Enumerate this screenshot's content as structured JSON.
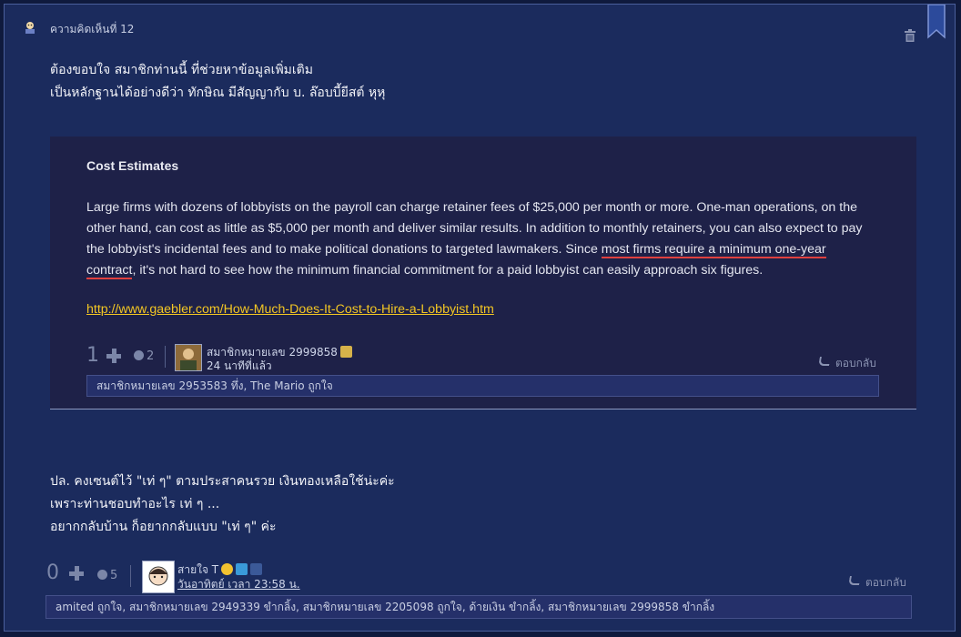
{
  "comment": {
    "label": "ความคิดเห็นที่ 12",
    "message_lines": [
      "ต้องขอบใจ สมาชิกท่านนี้ ที่ช่วยหาข้อมูลเพิ่มเติม",
      "เป็นหลักฐานได้อย่างดีว่า ทักษิณ มีสัญญากับ บ. ล๊อบบี้ยีสต์ หุหุ"
    ],
    "quote": {
      "title": "Cost Estimates",
      "para_before": "Large firms with dozens of lobbyists on the payroll can charge retainer fees of $25,000 per month or more. One-man operations, on the other hand, can cost as little as $5,000 per month and deliver similar results. In addition to monthly retainers, you can also expect to pay the lobbyist's incidental fees and to make political donations to targeted lawmakers. Since ",
      "para_underlined": "most firms require a minimum one-year contract",
      "para_after": ", it's not hard to see how the minimum financial commitment for a paid lobbyist can easily approach six figures.",
      "link": "http://www.gaebler.com/How-Much-Does-It-Cost-to-Hire-a-Lobbyist.htm"
    },
    "quote_footer": {
      "votes": "1",
      "emotion_count": "2",
      "user_name": "สมาชิกหมายเลข 2999858",
      "time": "24 นาทีที่แล้ว",
      "reply_label": "ตอบกลับ",
      "likes": "สมาชิกหมายเลข 2953583 ทึ่ง, The Mario ถูกใจ"
    },
    "message2_lines": [
      "ปล. คงเซนต์ไว้ \"เท่ ๆ\" ตามประสาคนรวย เงินทองเหลือใช้น่ะค่ะ",
      "เพราะท่านชอบทำอะไร เท่ ๆ ...",
      "อยากกลับบ้าน ก็อยากกลับแบบ \"เท่ ๆ\" ค่ะ"
    ],
    "footer": {
      "votes": "0",
      "emotion_count": "5",
      "user_name": "สายใจ T",
      "time": "วันอาทิตย์ เวลา 23:58 น.",
      "reply_label": "ตอบกลับ",
      "likes": "amited ถูกใจ, สมาชิกหมายเลข 2949339 ขำกลิ้ง, สมาชิกหมายเลข 2205098 ถูกใจ, ด้ายเงิน ขำกลิ้ง, สมาชิกหมายเลข 2999858 ขำกลิ้ง"
    }
  },
  "colors": {
    "background": "#1b2b5d",
    "quote_background": "#1e2148",
    "link": "#f3c623",
    "underline": "#e0403f"
  }
}
